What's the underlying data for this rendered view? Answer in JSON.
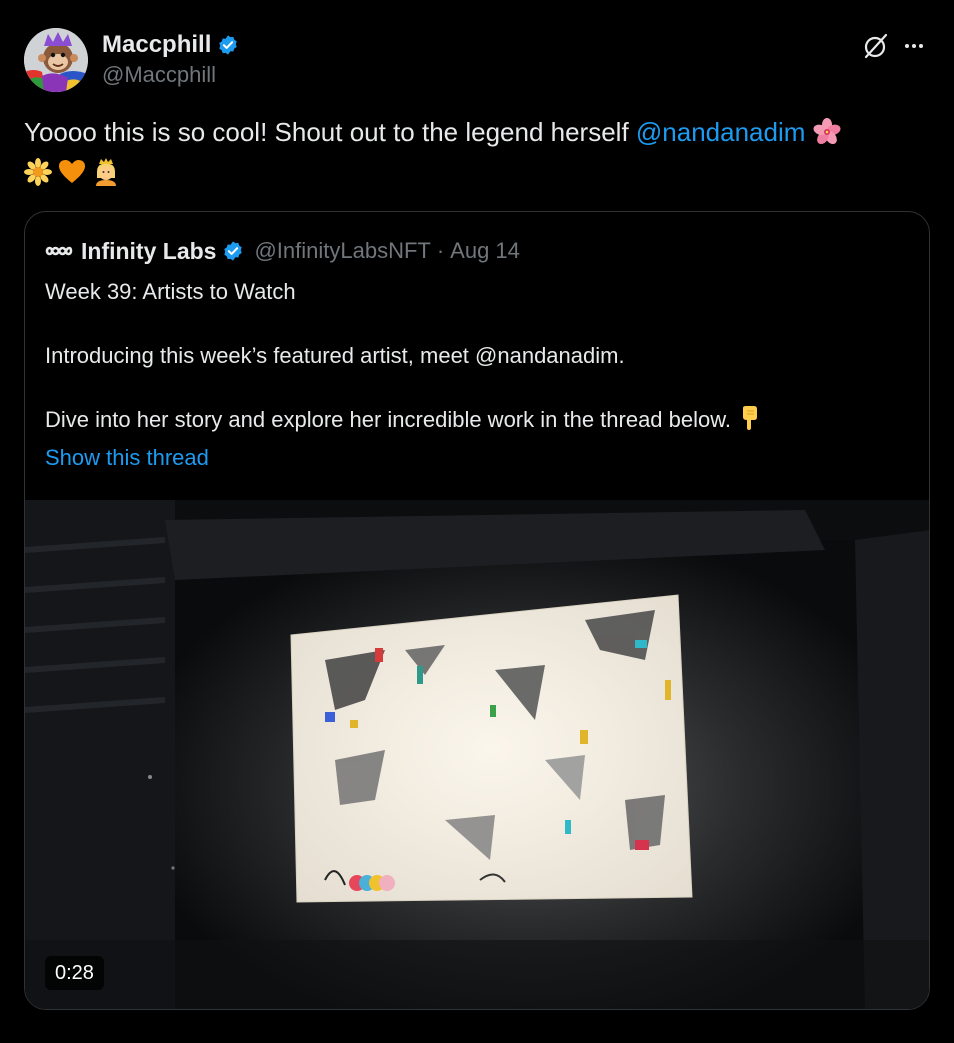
{
  "tweet": {
    "display_name": "Maccphill",
    "handle": "@Maccphill",
    "text_part1": "Yoooo this is so cool! Shout out to the legend herself ",
    "mention": "@nandanadim",
    "emojis": [
      "hibiscus",
      "blossom",
      "orange-heart",
      "person-with-crown"
    ]
  },
  "quote": {
    "display_name": "Infinity Labs",
    "handle": "@InfinityLabsNFT",
    "dot": "·",
    "date": "Aug 14",
    "line1": "Week 39: Artists to Watch",
    "line2": "Introducing this week’s featured artist, meet @nandanadim.",
    "line3": "Dive into her story and explore her incredible work in the thread below.",
    "show_thread": "Show this thread",
    "video_duration": "0:28"
  },
  "colors": {
    "background": "#000000",
    "text": "#e7e9ea",
    "muted": "#71767b",
    "link": "#1d9bf0",
    "border": "#2f3336",
    "verified": "#1d9bf0"
  }
}
